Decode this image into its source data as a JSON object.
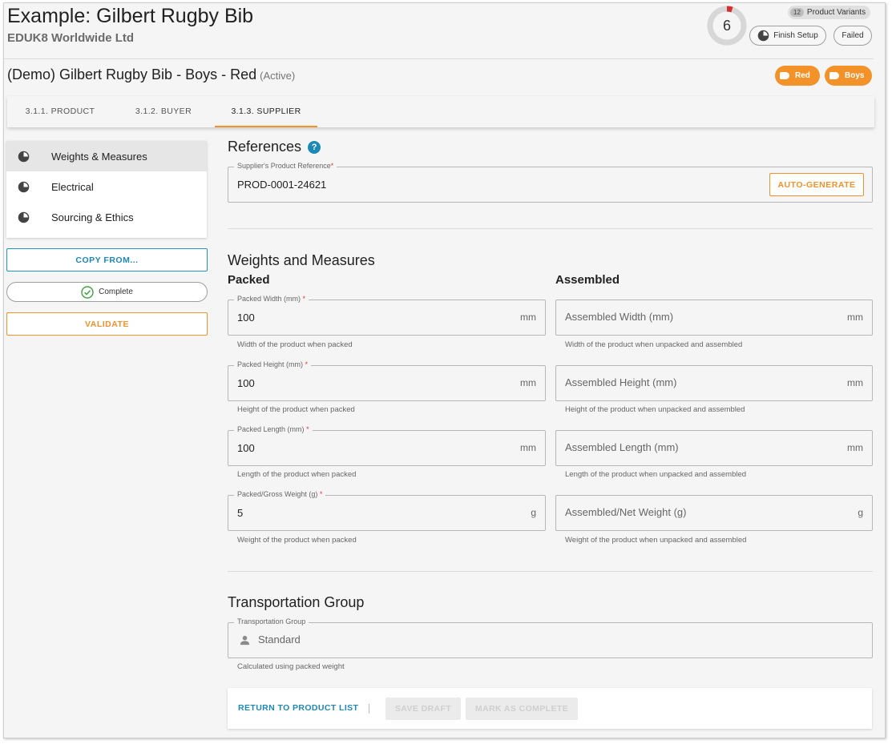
{
  "header": {
    "title": "Example: Gilbert Rugby Bib",
    "subtitle": "EDUK8 Worldwide Ltd",
    "progress_number": "6",
    "variants_count": "12",
    "variants_label": "Product Variants",
    "finish_setup_label": "Finish Setup",
    "failed_label": "Failed"
  },
  "product": {
    "title": "(Demo) Gilbert Rugby Bib - Boys - Red",
    "status": "(Active)",
    "tags": [
      "Red",
      "Boys"
    ],
    "accent_color": "#f39229"
  },
  "tabs": [
    {
      "label": "3.1.1. PRODUCT"
    },
    {
      "label": "3.1.2. BUYER"
    },
    {
      "label": "3.1.3. SUPPLIER"
    }
  ],
  "sidebar": {
    "items": [
      {
        "label": "Weights & Measures"
      },
      {
        "label": "Electrical"
      },
      {
        "label": "Sourcing & Ethics"
      }
    ],
    "copy_from_label": "COPY FROM...",
    "complete_label": "Complete",
    "validate_label": "VALIDATE"
  },
  "references": {
    "heading": "References",
    "help_symbol": "?",
    "field_label": "Supplier's Product Reference",
    "required_mark": "*",
    "value": "PROD-0001-24621",
    "auto_generate_label": "AUTO-GENERATE"
  },
  "weights": {
    "heading": "Weights and Measures",
    "packed_heading": "Packed",
    "assembled_heading": "Assembled",
    "packed": [
      {
        "label": "Packed Width (mm)",
        "value": "100",
        "unit": "mm",
        "hint": "Width of the product when packed"
      },
      {
        "label": "Packed Height (mm)",
        "value": "100",
        "unit": "mm",
        "hint": "Height of the product when packed"
      },
      {
        "label": "Packed Length (mm)",
        "value": "100",
        "unit": "mm",
        "hint": "Length of the product when packed"
      },
      {
        "label": "Packed/Gross Weight (g)",
        "value": "5",
        "unit": "g",
        "hint": "Weight of the product when packed"
      }
    ],
    "assembled": [
      {
        "placeholder": "Assembled Width (mm)",
        "unit": "mm",
        "hint": "Width of the product when unpacked and assembled"
      },
      {
        "placeholder": "Assembled Height (mm)",
        "unit": "mm",
        "hint": "Height of the product when unpacked and assembled"
      },
      {
        "placeholder": "Assembled Length (mm)",
        "unit": "mm",
        "hint": "Length of the product when unpacked and assembled"
      },
      {
        "placeholder": "Assembled/Net Weight (g)",
        "unit": "g",
        "hint": "Weight of the product when unpacked and assembled"
      }
    ]
  },
  "transport": {
    "heading": "Transportation Group",
    "field_label": "Transportation Group",
    "value": "Standard",
    "hint": "Calculated using packed weight"
  },
  "footer": {
    "return_label": "RETURN TO PRODUCT LIST",
    "save_draft_label": "SAVE DRAFT",
    "mark_complete_label": "MARK AS COMPLETE"
  }
}
